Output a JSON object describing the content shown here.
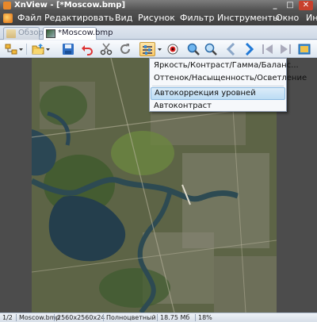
{
  "titlebar": {
    "title": "XnView - [*Moscow.bmp]",
    "min": "_",
    "max": "□",
    "close": "✕"
  },
  "menu": [
    "Файл",
    "Редактировать",
    "Вид",
    "Рисунок",
    "Фильтр",
    "Инструменты",
    "Окно",
    "Инфо"
  ],
  "tabs": {
    "browser": "Обзор",
    "image": "*Moscow.bmp"
  },
  "toolbar": {
    "icons": [
      "workflow-icon",
      "open-folder-icon",
      "save-icon",
      "undo-icon",
      "cut-icon",
      "refresh-icon",
      "adjust-icon",
      "redeye-icon",
      "zoom-in-icon",
      "zoom-out-icon",
      "prev-icon",
      "next-icon",
      "first-icon",
      "last-icon",
      "slideshow-icon"
    ]
  },
  "dropdown": {
    "items": [
      "Яркость/Контраст/Гамма/Баланс...",
      "Оттенок/Насыщенность/Осветление",
      "Автокоррекция уровней",
      "Автоконтраст"
    ],
    "highlighted": 2
  },
  "statusbar": {
    "page": "1/2",
    "filename": "Moscow.bmp",
    "dimensions": "2560x2560x24",
    "mode": "Полноцветный",
    "size": "18.75 Мб",
    "zoom": "18%"
  },
  "colors": {
    "accent": "#e8882a",
    "highlight": "#bcdcf4",
    "titlebar": "#4e4e4e"
  }
}
